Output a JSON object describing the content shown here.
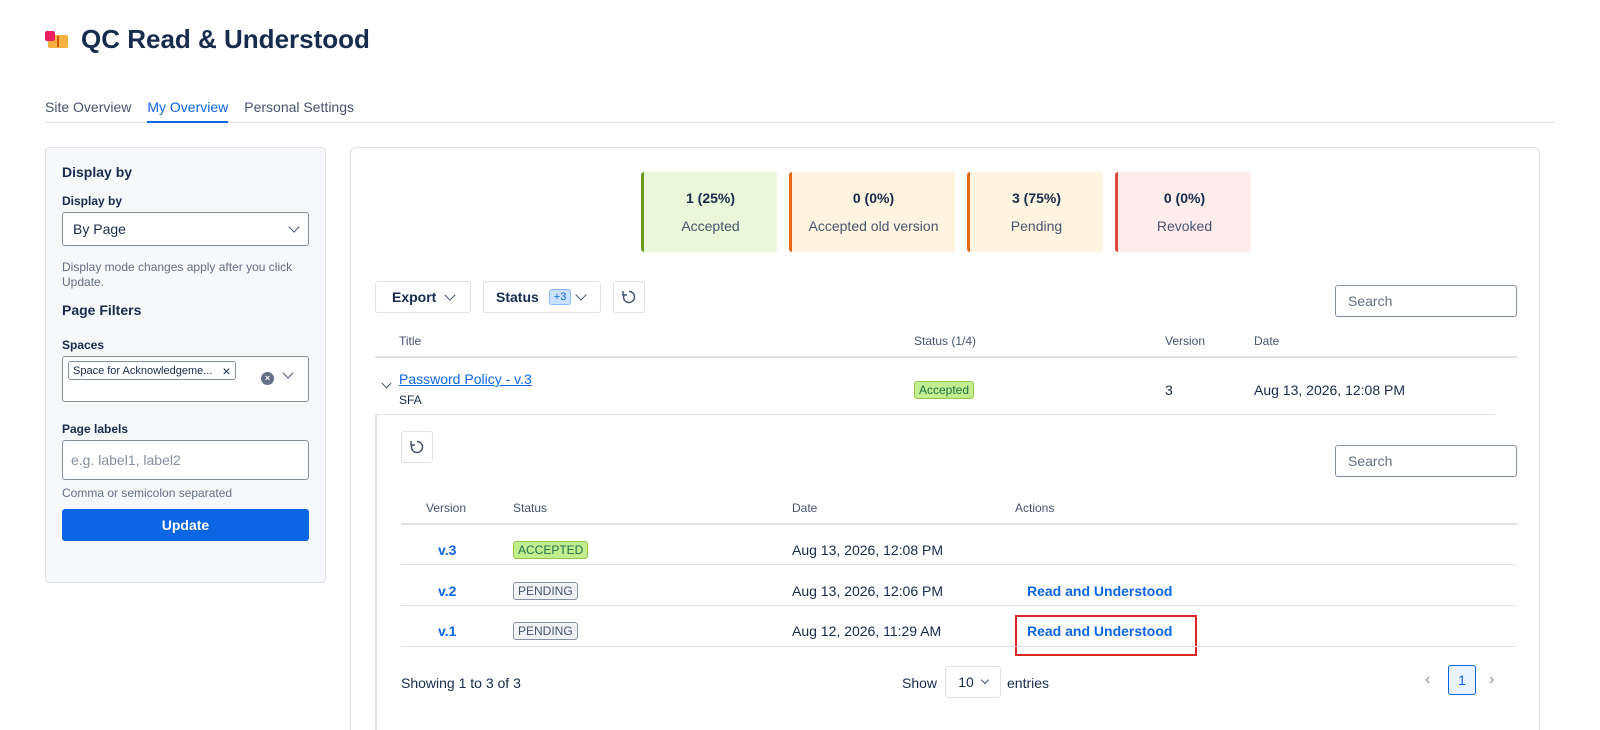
{
  "app": {
    "title": "QC Read & Understood"
  },
  "tabs": [
    {
      "label": "Site Overview"
    },
    {
      "label": "My Overview"
    },
    {
      "label": "Personal Settings"
    }
  ],
  "sidebar": {
    "display_heading": "Display by",
    "display_label": "Display by",
    "display_value": "By Page",
    "display_help": "Display mode changes apply after you click Update.",
    "filters_heading": "Page Filters",
    "spaces_label": "Spaces",
    "space_chip": "Space for Acknowledgeme...",
    "labels_label": "Page labels",
    "labels_placeholder": "e.g. label1, label2",
    "labels_help": "Comma or semicolon separated",
    "update_button": "Update"
  },
  "stats": [
    {
      "value": "1 (25%)",
      "label": "Accepted",
      "bg": "#eaf8d9",
      "border": "#6a9a23"
    },
    {
      "value": "0 (0%)",
      "label": "Accepted old version",
      "bg": "#fff4e0",
      "border": "#e56910"
    },
    {
      "value": "3 (75%)",
      "label": "Pending",
      "bg": "#fff4e0",
      "border": "#e56910"
    },
    {
      "value": "0 (0%)",
      "label": "Revoked",
      "bg": "#ffeceb",
      "border": "#e2483d"
    }
  ],
  "toolbar": {
    "export_label": "Export",
    "status_label": "Status",
    "status_count": "+3",
    "search_placeholder": "Search"
  },
  "table": {
    "columns": [
      "Title",
      "Status (1/4)",
      "Version",
      "Date"
    ],
    "rows": [
      {
        "title": "Password Policy - v.3",
        "space": "SFA",
        "status": "Accepted",
        "version": "3",
        "date": "Aug 13, 2026, 12:08 PM"
      }
    ]
  },
  "detail": {
    "search_placeholder": "Search",
    "columns": [
      "Version",
      "Status",
      "Date",
      "Actions"
    ],
    "rows": [
      {
        "version": "v.3",
        "status": "ACCEPTED",
        "date": "Aug 13, 2026, 12:08 PM",
        "action": ""
      },
      {
        "version": "v.2",
        "status": "PENDING",
        "date": "Aug 13, 2026, 12:06 PM",
        "action": "Read and Understood"
      },
      {
        "version": "v.1",
        "status": "PENDING",
        "date": "Aug 12, 2026, 11:29 AM",
        "action": "Read and Understood"
      }
    ],
    "showing": "Showing 1 to 3 of 3",
    "show_label": "Show",
    "page_size": "10",
    "entries_label": "entries",
    "current_page": "1"
  }
}
